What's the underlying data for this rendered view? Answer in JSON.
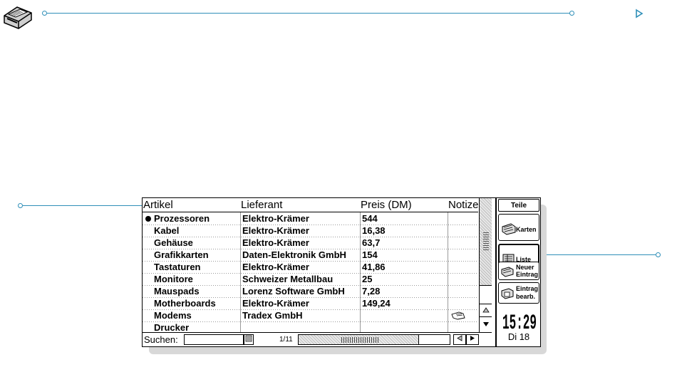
{
  "table": {
    "headers": [
      "Artikel",
      "Lieferant",
      "Preis (DM)",
      "Notize"
    ],
    "rows": [
      {
        "artikel": "Prozessoren",
        "lieferant": "Elektro-Krämer",
        "preis": "544"
      },
      {
        "artikel": "Kabel",
        "lieferant": "Elektro-Krämer",
        "preis": "16,38"
      },
      {
        "artikel": "Gehäuse",
        "lieferant": "Elektro-Krämer",
        "preis": "63,7"
      },
      {
        "artikel": "Grafikkarten",
        "lieferant": "Daten-Elektronik GmbH",
        "preis": "154"
      },
      {
        "artikel": "Tastaturen",
        "lieferant": "Elektro-Krämer",
        "preis": "41,86"
      },
      {
        "artikel": "Monitore",
        "lieferant": "Schweizer Metallbau",
        "preis": "25"
      },
      {
        "artikel": "Mauspads",
        "lieferant": "Lorenz Software GmbH",
        "preis": "7,28"
      },
      {
        "artikel": "Motherboards",
        "lieferant": "Elektro-Krämer",
        "preis": "149,24"
      },
      {
        "artikel": "Modems",
        "lieferant": "Tradex GmbH",
        "preis": ""
      },
      {
        "artikel": "Drucker",
        "lieferant": "",
        "preis": ""
      }
    ]
  },
  "bottombar": {
    "search_label": "Suchen:",
    "page_counter": "1/11"
  },
  "panel": {
    "title": "Teile",
    "karten": "Karten",
    "liste": "Liste",
    "neuer_line1": "Neuer",
    "neuer_line2": "Eintrag",
    "bearb_line1": "Eintrag",
    "bearb_line2": "bearb."
  },
  "clock": {
    "time": "15:29",
    "date": "Di 18"
  },
  "colors": {
    "callout": "#2f8fb8"
  },
  "icons": [
    "app-icon",
    "list-view-icon",
    "scroll-up-icon",
    "scroll-down-icon",
    "scroll-left-icon",
    "scroll-right-icon",
    "karten-icon",
    "liste-icon",
    "neuer-eintrag-icon",
    "eintrag-bearb-icon",
    "note-hand-icon",
    "play-arrow-icon"
  ]
}
